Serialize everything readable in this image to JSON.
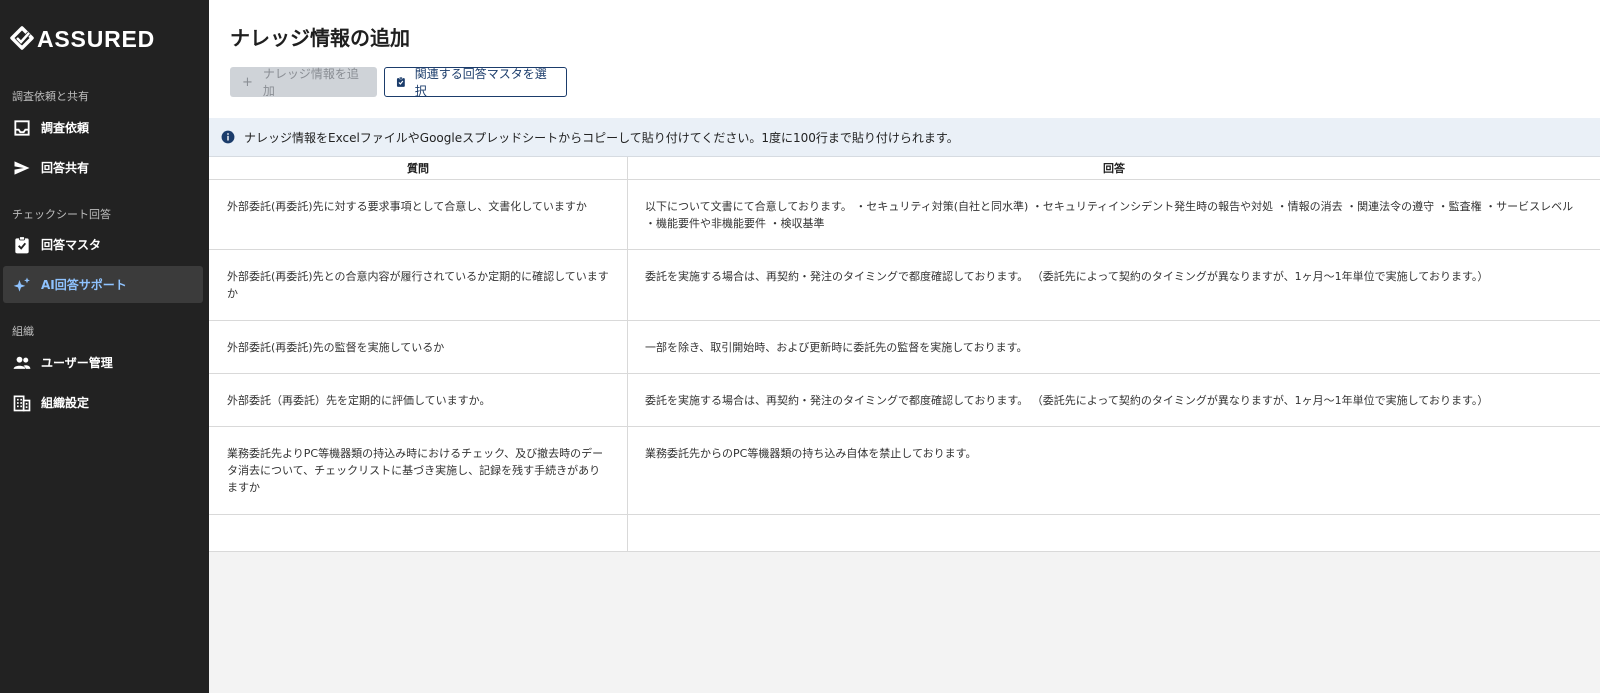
{
  "brand": {
    "name": "ASSURED"
  },
  "sidebar": {
    "sections": [
      {
        "label": "調査依頼と共有",
        "items": [
          {
            "label": "調査依頼",
            "icon": "inbox-icon"
          },
          {
            "label": "回答共有",
            "icon": "send-icon"
          }
        ]
      },
      {
        "label": "チェックシート回答",
        "items": [
          {
            "label": "回答マスタ",
            "icon": "clipboard-check-icon"
          },
          {
            "label": "AI回答サポート",
            "icon": "sparkles-icon",
            "active": true
          }
        ]
      },
      {
        "label": "組織",
        "items": [
          {
            "label": "ユーザー管理",
            "icon": "users-icon"
          },
          {
            "label": "組織設定",
            "icon": "building-icon"
          }
        ]
      }
    ]
  },
  "header": {
    "title": "ナレッジ情報の追加",
    "add_button": "ナレッジ情報を追加",
    "select_button": "関連する回答マスタを選択"
  },
  "info": {
    "text": "ナレッジ情報をExcelファイルやGoogleスプレッドシートからコピーして貼り付けてください。1度に100行まで貼り付けられます。"
  },
  "table": {
    "headers": {
      "question": "質問",
      "answer": "回答"
    },
    "rows": [
      {
        "question": "外部委託(再委託)先に対する要求事項として合意し、文書化していますか",
        "answer": "以下について文書にて合意しております。 ・セキュリティ対策(自社と同水準) ・セキュリティインシデント発生時の報告や対処 ・情報の消去 ・関連法令の遵守 ・監査権 ・サービスレベル ・機能要件や非機能要件 ・検収基準"
      },
      {
        "question": "外部委託(再委託)先との合意内容が履行されているか定期的に確認していますか",
        "answer": "委託を実施する場合は、再契約・発注のタイミングで都度確認しております。 （委託先によって契約のタイミングが異なりますが、1ヶ月〜1年単位で実施しております。）"
      },
      {
        "question": "外部委託(再委託)先の監督を実施しているか",
        "answer": "一部を除き、取引開始時、および更新時に委託先の監督を実施しております。"
      },
      {
        "question": "外部委託（再委託）先を定期的に評価していますか。",
        "answer": "委託を実施する場合は、再契約・発注のタイミングで都度確認しております。 （委託先によって契約のタイミングが異なりますが、1ヶ月〜1年単位で実施しております。）"
      },
      {
        "question": "業務委託先よりPC等機器類の持込み時におけるチェック、及び撤去時のデータ消去について、チェックリストに基づき実施し、記録を残す手続きがありますか",
        "answer": "業務委託先からのPC等機器類の持ち込み自体を禁止しております。"
      },
      {
        "question": "",
        "answer": ""
      }
    ]
  }
}
